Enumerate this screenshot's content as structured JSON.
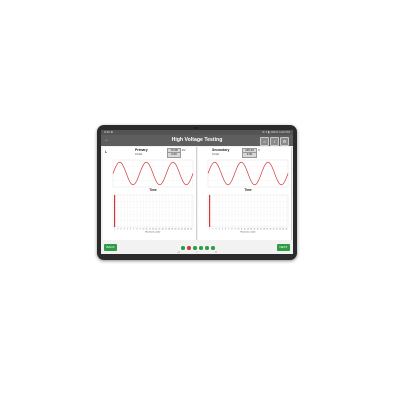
{
  "status_bar": {
    "left": "9:30 ⊕",
    "right": "⊛ ▾ ▮ 100% 4:22 PM"
  },
  "app_bar": {
    "title": "High Voltage Testing",
    "back_icon": "back-arrow-icon",
    "actions": [
      "home-icon",
      "info-icon",
      "settings-icon"
    ]
  },
  "panels": [
    {
      "label": "Primary",
      "sub_label": "0 kHz",
      "value": "73.58",
      "value2": "0.00",
      "unit": "kV",
      "side_label": "L",
      "wave_color": "#d0383a"
    },
    {
      "label": "Secondary",
      "sub_label": "0 kHz",
      "value": "235.20",
      "value2": "0.00",
      "unit": "V",
      "side_label": "",
      "wave_color": "#d0383a"
    }
  ],
  "x_axis_label": "Time",
  "spectrum_axis_label": "Harmonic order",
  "buttons": {
    "left": "BACK",
    "right": "NEXT"
  },
  "page_dots": [
    {
      "color": "#2e9d46"
    },
    {
      "color": "#d0383a"
    },
    {
      "color": "#2e9d46"
    },
    {
      "color": "#2e9d46"
    },
    {
      "color": "#2e9d46"
    },
    {
      "color": "#2e9d46"
    }
  ],
  "nav": {
    "back": "◁",
    "home": "○",
    "recent": "□"
  },
  "chart_data": [
    {
      "type": "line",
      "series": [
        {
          "values": [
            0,
            0.71,
            1,
            0.71,
            0,
            -0.71,
            -1,
            -0.71,
            0,
            0.71,
            1,
            0.71,
            0,
            -0.71,
            -1,
            -0.71,
            0,
            0.71,
            1,
            0.71,
            0,
            -0.71,
            -1,
            -0.71,
            0
          ]
        }
      ],
      "xlabel": "Time",
      "ylim": [
        -1.2,
        1.2
      ]
    },
    {
      "type": "line",
      "series": [
        {
          "values": [
            0,
            0.71,
            1,
            0.71,
            0,
            -0.71,
            -1,
            -0.71,
            0,
            0.71,
            1,
            0.71,
            0,
            -0.71,
            -1,
            -0.71,
            0,
            0.71,
            1,
            0.71,
            0,
            -0.71,
            -1,
            -0.71,
            0
          ]
        }
      ],
      "xlabel": "Time",
      "ylim": [
        -1.2,
        1.2
      ]
    },
    {
      "type": "bar",
      "categories": [
        "1",
        "2",
        "3",
        "4",
        "5",
        "6",
        "7",
        "8",
        "9",
        "10",
        "11",
        "12",
        "13",
        "14",
        "15",
        "16",
        "17",
        "18",
        "19",
        "20",
        "21",
        "22",
        "23",
        "24",
        "25"
      ],
      "values": [
        100,
        0,
        0,
        0,
        0,
        0,
        0,
        0,
        0,
        0,
        0,
        0,
        0,
        0,
        0,
        0,
        0,
        0,
        0,
        0,
        0,
        0,
        0,
        0,
        0
      ],
      "xlabel": "Harmonic order",
      "ylim": [
        0,
        100
      ]
    },
    {
      "type": "bar",
      "categories": [
        "1",
        "2",
        "3",
        "4",
        "5",
        "6",
        "7",
        "8",
        "9",
        "10",
        "11",
        "12",
        "13",
        "14",
        "15",
        "16",
        "17",
        "18",
        "19",
        "20",
        "21",
        "22",
        "23",
        "24",
        "25"
      ],
      "values": [
        100,
        0,
        0,
        0,
        0,
        0,
        0,
        0,
        0,
        0,
        0,
        0,
        0,
        0,
        0,
        0,
        0,
        0,
        0,
        0,
        0,
        0,
        0,
        0,
        0
      ],
      "xlabel": "Harmonic order",
      "ylim": [
        0,
        100
      ]
    }
  ]
}
